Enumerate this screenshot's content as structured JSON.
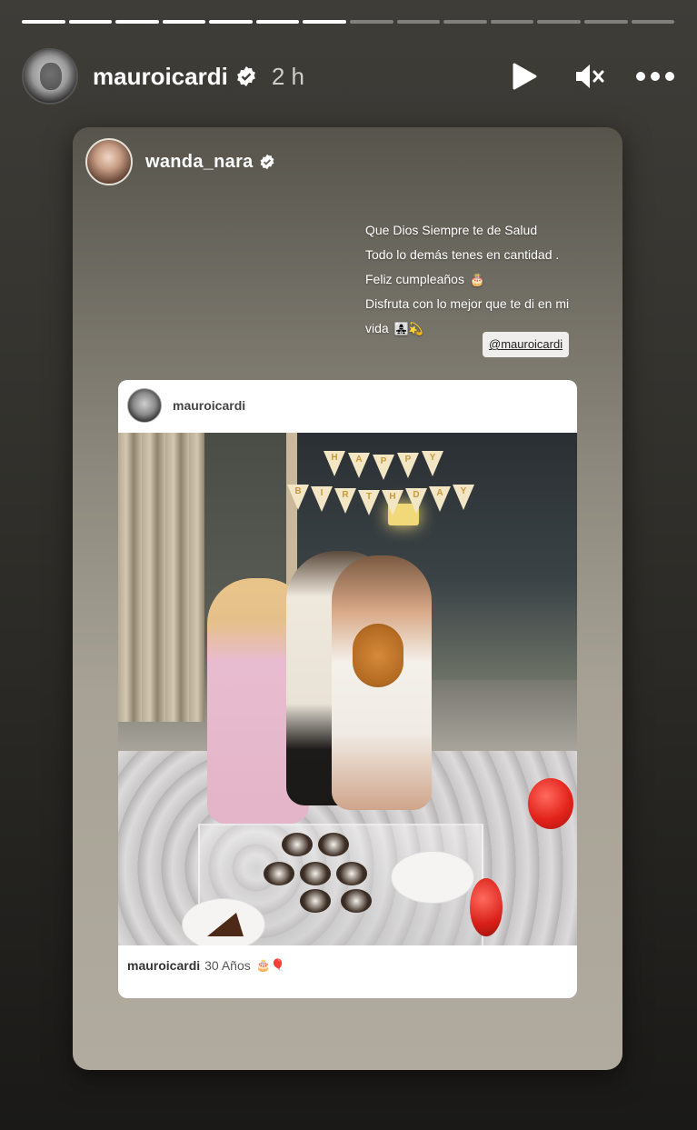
{
  "story": {
    "progress_segments": 14,
    "progress_done": 7,
    "user": "mauroicardi",
    "time": "2 h"
  },
  "card": {
    "user": "wanda_nara",
    "caption_lines": [
      "Que Dios Siempre te de Salud",
      "Todo lo demás tenes en cantidad .",
      "Feliz cumpleaños",
      "Disfruta con lo mejor que te di en mi",
      "vida"
    ],
    "mention": "@mauroicardi"
  },
  "post": {
    "user": "mauroicardi",
    "caption_user": "mauroicardi",
    "caption_text": "30 Años",
    "banner_top": [
      "H",
      "A",
      "P",
      "P",
      "Y"
    ],
    "banner_bottom": [
      "B",
      "I",
      "R",
      "T",
      "H",
      "D",
      "A",
      "Y"
    ]
  }
}
